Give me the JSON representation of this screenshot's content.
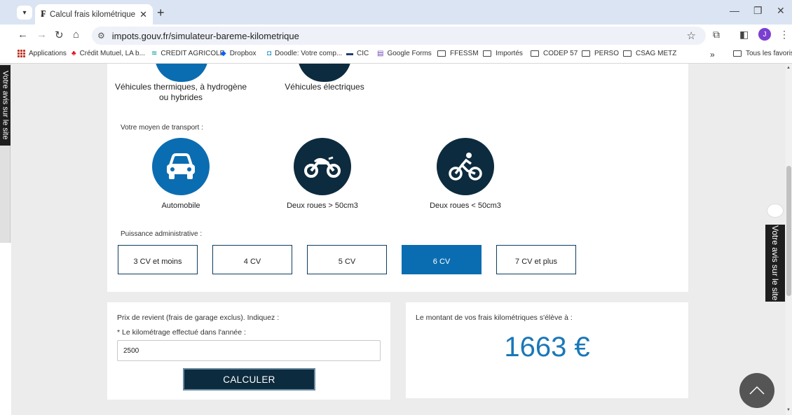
{
  "browser": {
    "tab_title": "Calcul frais kilométrique | impo",
    "tab_favicon": "₣",
    "url": "impots.gouv.fr/simulateur-bareme-kilometrique",
    "avatar_letter": "J",
    "bookmarks": [
      "Applications",
      "Crédit Mutuel, LA b...",
      "CREDIT AGRICOLE",
      "Dropbox",
      "Doodle: Votre comp...",
      "CIC",
      "Google Forms",
      "FFESSM",
      "Importés",
      "CODEP 57",
      "PERSO",
      "CSAG METZ"
    ],
    "bookmarks_more": "»",
    "all_bookmarks": "Tous les favoris"
  },
  "vehicle_types": [
    {
      "label": "Véhicules thermiques, à hydrogène ou hybrides",
      "color": "#0b6db1"
    },
    {
      "label": "Véhicules électriques",
      "color": "#0d2b3e"
    }
  ],
  "transport": {
    "label": "Votre moyen de transport :",
    "options": [
      {
        "label": "Automobile",
        "icon": "car-icon",
        "color": "#0b6db1"
      },
      {
        "label": "Deux roues > 50cm3",
        "icon": "motorbike-icon",
        "color": "#0d2b3e"
      },
      {
        "label": "Deux roues < 50cm3",
        "icon": "bicycle-icon",
        "color": "#0d2b3e"
      }
    ]
  },
  "power": {
    "label": "Puissance administrative :",
    "options": [
      "3 CV et moins",
      "4 CV",
      "5 CV",
      "6 CV",
      "7 CV et plus"
    ],
    "selected": "6 CV"
  },
  "form": {
    "prix_label": "Prix de revient (frais de garage exclus). Indiquez :",
    "km_label": "* Le kilométrage effectué dans l'année :",
    "km_value": "2500",
    "button": "CALCULER"
  },
  "result": {
    "label": "Le montant de vos frais kilométriques s'élève à :",
    "amount": "1663 €"
  },
  "feedback": "Votre avis sur le site"
}
